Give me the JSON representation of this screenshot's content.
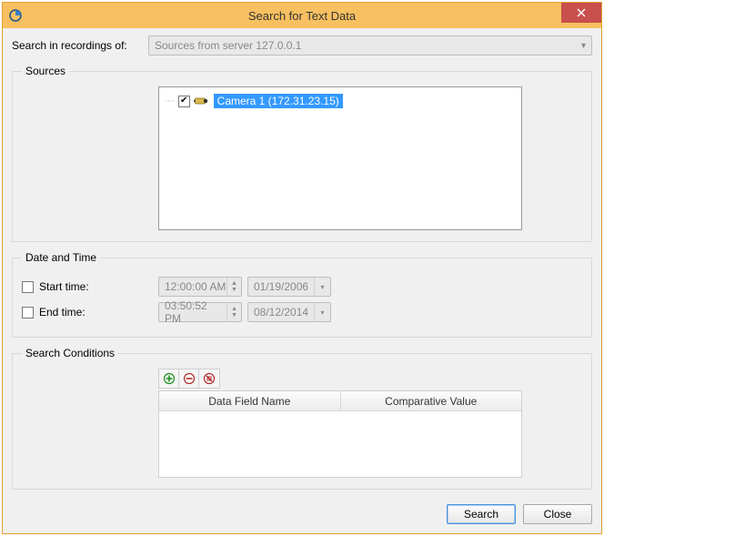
{
  "window": {
    "title": "Search for Text Data"
  },
  "searchIn": {
    "label": "Search in recordings of:",
    "value": "Sources from server 127.0.0.1"
  },
  "sources": {
    "legend": "Sources",
    "items": [
      {
        "checked": true,
        "label": "Camera 1 (172.31.23.15)"
      }
    ]
  },
  "dateTime": {
    "legend": "Date and Time",
    "start": {
      "label": "Start time:",
      "time": "12:00:00 AM",
      "date": "01/19/2006",
      "checked": false
    },
    "end": {
      "label": "End time:",
      "time": "03:50:52 PM",
      "date": "08/12/2014",
      "checked": false
    }
  },
  "conditions": {
    "legend": "Search Conditions",
    "columns": {
      "field": "Data Field Name",
      "value": "Comparative Value"
    }
  },
  "footer": {
    "search": "Search",
    "close": "Close"
  }
}
